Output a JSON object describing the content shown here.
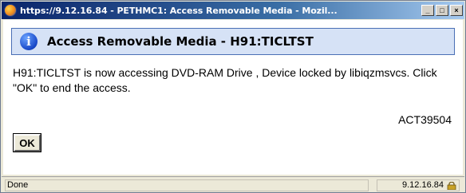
{
  "window": {
    "title": "https://9.12.16.84 - PETHMC1: Access Removable Media - Mozil...",
    "buttons": {
      "minimize": "_",
      "maximize": "□",
      "close": "×"
    }
  },
  "header": {
    "icon": "info-icon",
    "title": "Access Removable Media - H91:TICLTST"
  },
  "message": "H91:TICLTST is now accessing DVD-RAM Drive , Device locked by libiqzmsvcs. Click \"OK\" to end the access.",
  "message_code": "ACT39504",
  "ok_button": {
    "label": "OK"
  },
  "statusbar": {
    "text": "Done",
    "host": "9.12.16.84",
    "host_icon": "secure-lock-icon"
  }
}
